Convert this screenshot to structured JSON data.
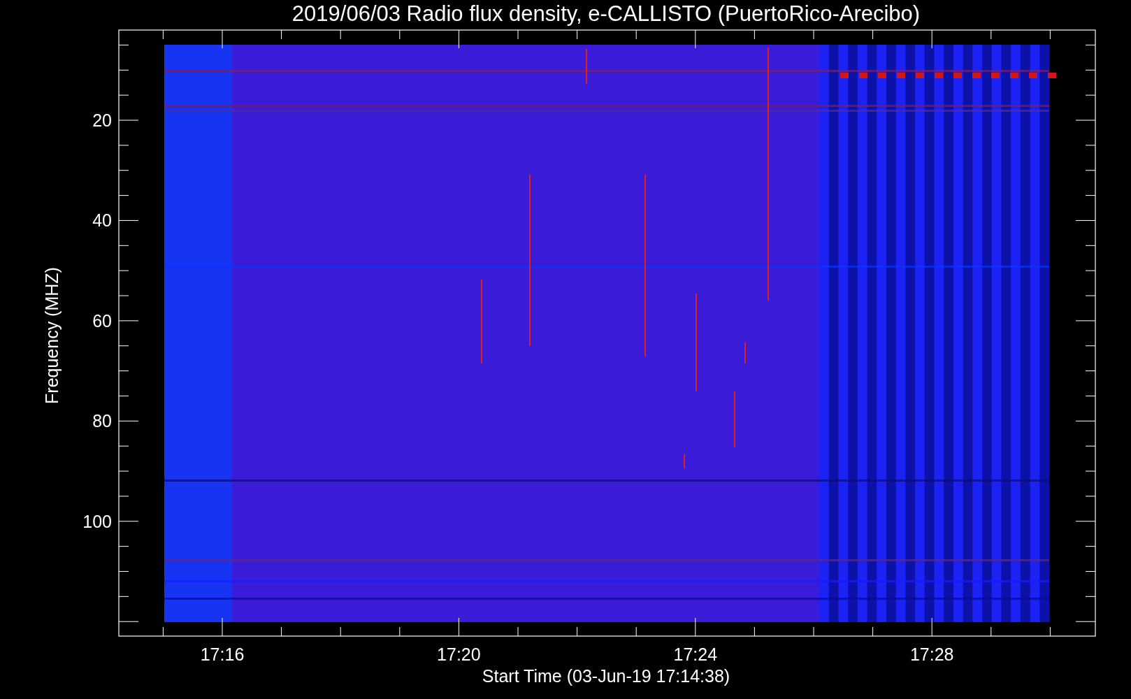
{
  "title": "2019/06/03  Radio flux density, e-CALLISTO (PuertoRico-Arecibo)",
  "xlabel": "Start Time (03-Jun-19 17:14:38)",
  "ylabel": "Frequency (MHZ)",
  "xtick_labels": [
    "17:16",
    "17:20",
    "17:24",
    "17:28"
  ],
  "ytick_labels": [
    "20",
    "40",
    "60",
    "80",
    "100"
  ]
}
